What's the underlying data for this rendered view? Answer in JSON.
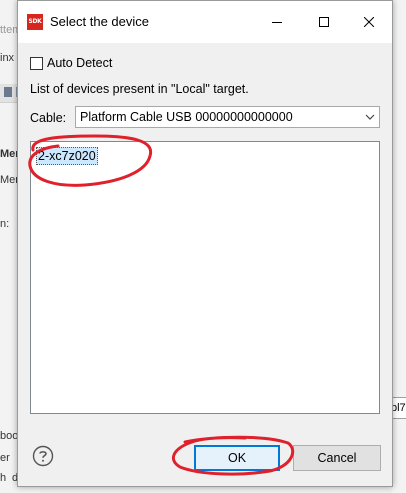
{
  "background": {
    "left_fragments": [
      "ttem",
      "inx",
      "Men",
      "Men",
      "n:",
      "boo",
      "er",
      "d",
      "h"
    ],
    "right_field": "bl7"
  },
  "dialog": {
    "title": "Select the device",
    "app_icon_text": "SDK",
    "auto_detect_label": "Auto Detect",
    "auto_detect_checked": false,
    "info_text": "List of devices present in \"Local\" target.",
    "cable_label": "Cable:",
    "cable_value": "Platform Cable USB 00000000000000",
    "devices": [
      "2-xc7z020"
    ],
    "selected_device": "2-xc7z020",
    "ok_label": "OK",
    "cancel_label": "Cancel"
  },
  "colors": {
    "annotation": "#e0202a",
    "accent": "#0078d7",
    "selection": "#cce8ff",
    "app_icon": "#d7261e"
  },
  "icons": {
    "app": "sdk-app-icon",
    "minimize": "minimize-icon",
    "maximize": "maximize-icon",
    "close": "close-icon",
    "dropdown": "chevron-down-icon",
    "help": "help-icon"
  }
}
